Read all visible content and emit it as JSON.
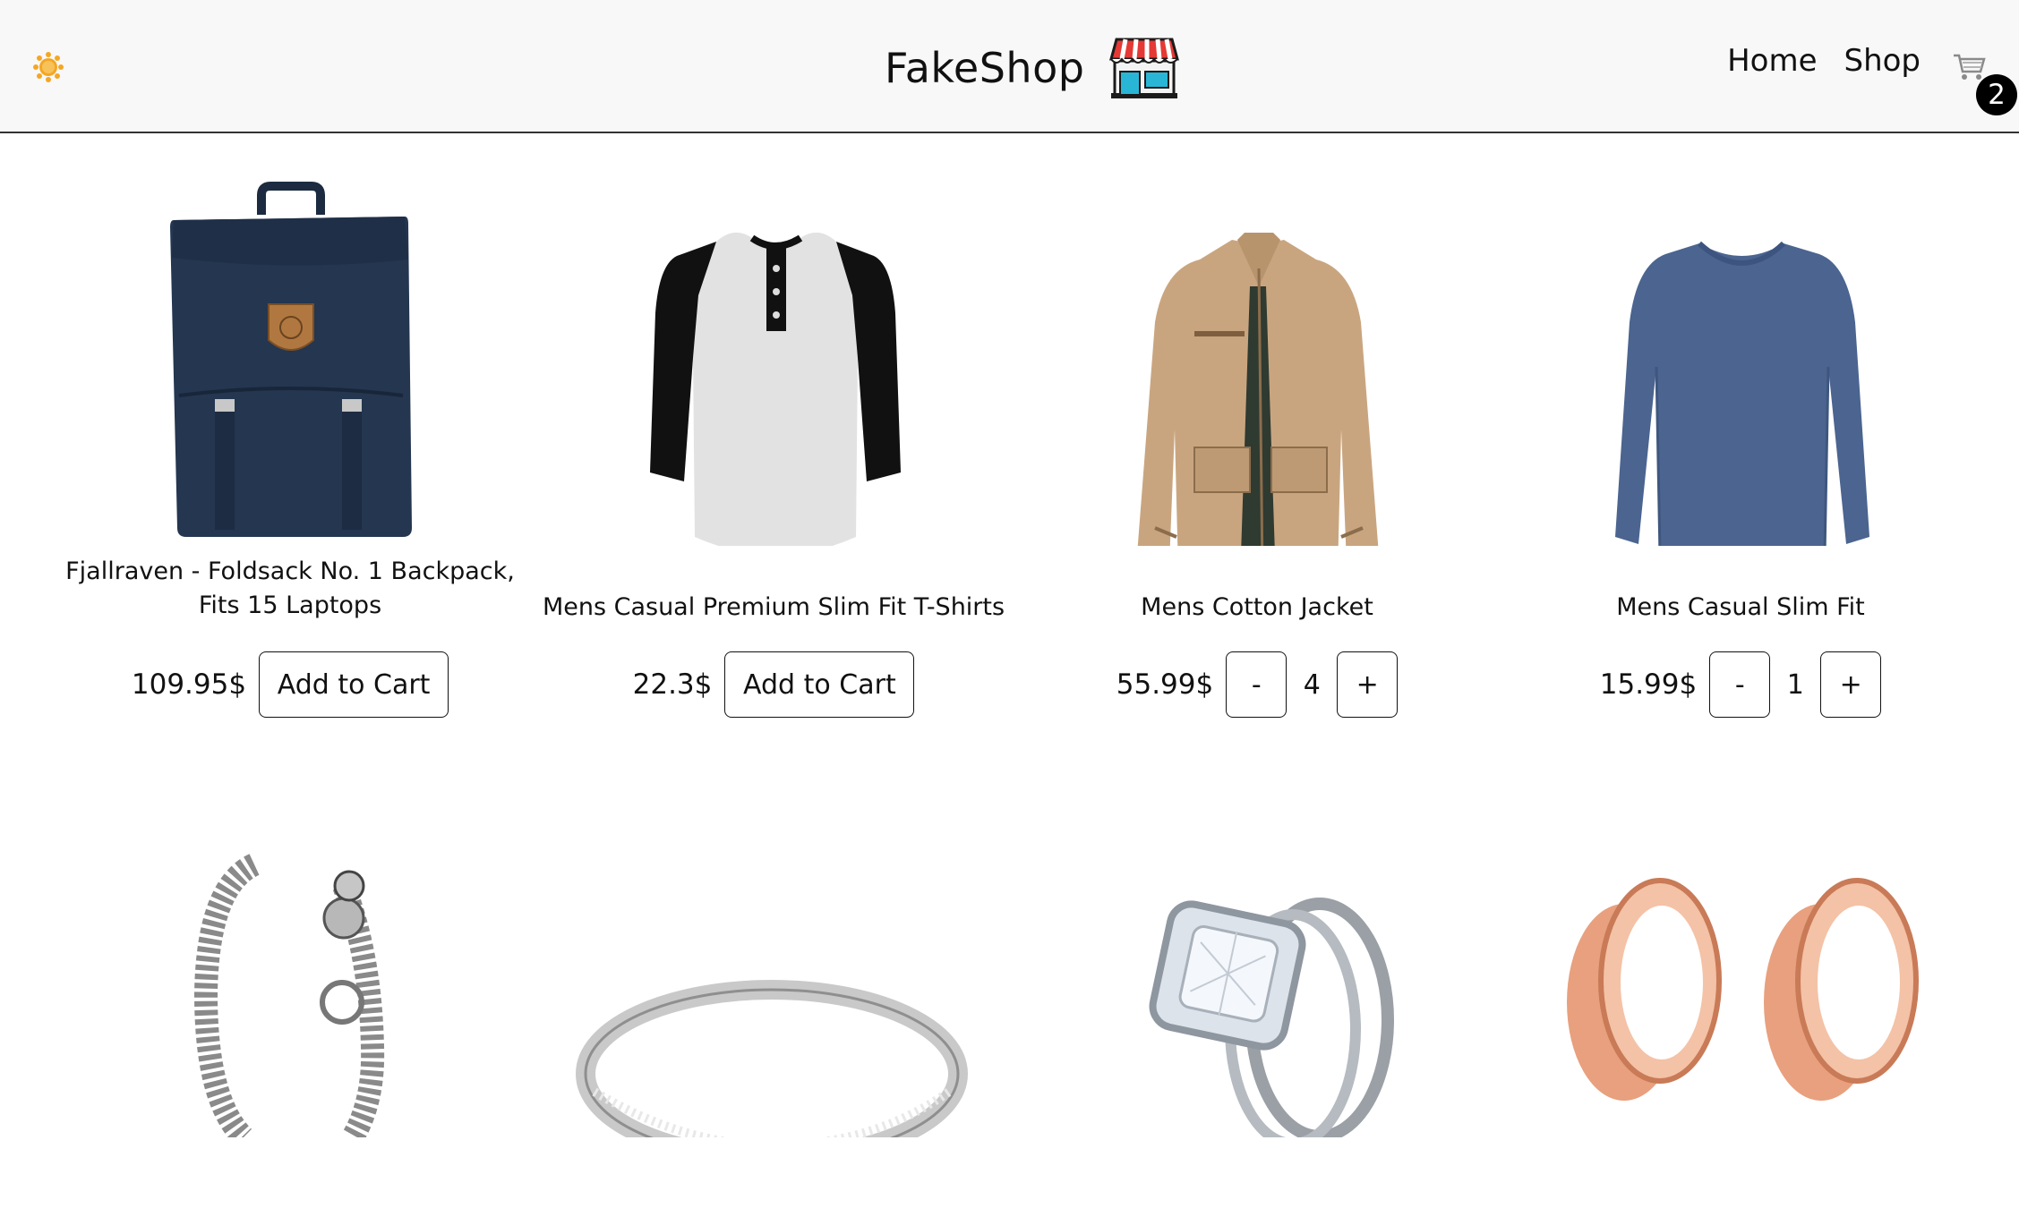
{
  "header": {
    "brand": "FakeShop",
    "nav": {
      "home": "Home",
      "shop": "Shop"
    },
    "cart_count": "2",
    "icons": [
      "sun-icon",
      "storefront-icon",
      "shopping-cart-icon"
    ]
  },
  "products": [
    {
      "title": "Fjallraven - Foldsack No. 1 Backpack, Fits 15 Laptops",
      "price": "109.95$",
      "add_label": "Add to Cart"
    },
    {
      "title": "Mens Casual Premium Slim Fit T-Shirts",
      "price": "22.3$",
      "add_label": "Add to Cart"
    },
    {
      "title": "Mens Cotton Jacket",
      "price": "55.99$",
      "minus": "-",
      "qty": "4",
      "plus": "+"
    },
    {
      "title": "Mens Casual Slim Fit",
      "price": "15.99$",
      "minus": "-",
      "qty": "1",
      "plus": "+"
    },
    {
      "title": "",
      "image": "bracelet"
    },
    {
      "title": "",
      "image": "ring"
    },
    {
      "title": "",
      "image": "diamond-ring"
    },
    {
      "title": "",
      "image": "tunnels"
    }
  ],
  "colors": {
    "header_bg": "#f8f8f8",
    "sun": "#f5a623",
    "backpack": "#243650",
    "jacket": "#c9a57f",
    "sweater": "#4b6490",
    "rose_gold": "#e8a07e"
  }
}
